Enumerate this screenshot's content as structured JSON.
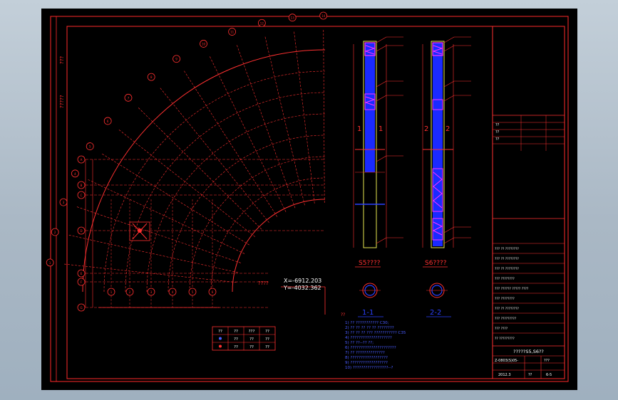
{
  "colors": {
    "background": "#000000",
    "frame": "#ff2a2a",
    "text": "#ffffff",
    "grid": "#ff2a2a",
    "column_fill": "#1a2aff",
    "magenta": "#ff33ff",
    "yellow": "#e8e850"
  },
  "coordinate": {
    "label": "????",
    "x": "X=-6912.203",
    "y": "Y=-4032.362"
  },
  "side_label_top": "???",
  "side_label_mid": "?????",
  "sections": {
    "elev1_title": "S5????",
    "elev2_title": "S6????",
    "sec1_label": "1-1",
    "sec2_label": "2-2",
    "cut1_left": "1",
    "cut1_right": "1",
    "cut2_left": "2",
    "cut2_right": "2"
  },
  "notes": {
    "heading": "??",
    "lines": [
      "1) ?? ??????????? C30;",
      "2) ?? ?? ?? ?? ?? ????????",
      "3) ?? ?? ?? ??? ??????????? C35",
      "4) ????????????????????",
      "5) ?? ??--?? ??;",
      "6) ??????????????????????",
      "7) ?? ??????????????",
      "8) ??????????????????",
      "9) ??????????????????",
      "10) ?????????????????--?"
    ]
  },
  "legend": {
    "rows": [
      [
        "??",
        "??",
        "???",
        "??"
      ],
      [
        "",
        "??",
        "??",
        "??"
      ],
      [
        "",
        "??",
        "??",
        "??"
      ]
    ]
  },
  "title_block": {
    "rev_rows": [
      "??",
      "??",
      "??"
    ],
    "sign_rows": [
      "???  ?? ????????",
      "???  ?? ????????",
      "???  ?? ????????",
      "???  ????????",
      "???  ?????? ????? ????",
      "???  ????????",
      "???  ?? ????????",
      "???  ?????????",
      "???  ????",
      "?? ?????????"
    ],
    "drawing_name": "?????S5,S6??",
    "drawing_no": "Z-0803(S)05-",
    "scale": "???",
    "date": "2012.3",
    "sheet": "??",
    "sheet_no": "6-5"
  },
  "axis_bubbles": [
    "1",
    "2",
    "3",
    "4",
    "5",
    "6",
    "7",
    "8",
    "9",
    "10",
    "11",
    "12",
    "13",
    "14"
  ],
  "row_bubbles": [
    "A",
    "B",
    "C",
    "D",
    "E",
    "F",
    "G",
    "H"
  ],
  "bottom_bubbles": [
    "1",
    "2",
    "3",
    "4",
    "5",
    "6"
  ]
}
